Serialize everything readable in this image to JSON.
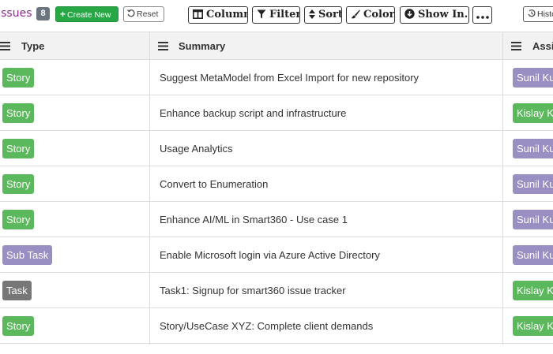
{
  "toolbar": {
    "title": "Issues",
    "count": "8",
    "create_label": "Create New",
    "reset_label": "Reset",
    "column_label": "Column",
    "filter_label": "Filter",
    "sort_label": "Sort",
    "color_label": "Color",
    "show_in_label": "Show In...",
    "history_label": "Histo"
  },
  "table": {
    "columns": [
      "Type",
      "Summary",
      "Assi"
    ],
    "rows": [
      {
        "type": "Story",
        "summary": "Suggest MetaModel from Excel Import for new repository",
        "assignee": "Sunil Ku"
      },
      {
        "type": "Story",
        "summary": "Enhance backup script and infrastructure",
        "assignee": "Kislay K"
      },
      {
        "type": "Story",
        "summary": "Usage Analytics",
        "assignee": "Sunil Ku"
      },
      {
        "type": "Story",
        "summary": "Convert to Enumeration",
        "assignee": "Sunil Ku"
      },
      {
        "type": "Story",
        "summary": "Enhance AI/ML in Smart360 - Use case 1",
        "assignee": "Sunil Ku"
      },
      {
        "type": "Sub Task",
        "summary": "Enable Microsoft login via Azure Active Directory",
        "assignee": "Sunil Ku"
      },
      {
        "type": "Task",
        "summary": "Task1: Signup for smart360 issue tracker",
        "assignee": "Kislay K"
      },
      {
        "type": "Story",
        "summary": "Story/UseCase XYZ: Complete client demands",
        "assignee": "Kislay K"
      }
    ]
  },
  "colors": {
    "story": "#5cb85c",
    "sub_task": "#9a8fc2",
    "task": "#777777",
    "assignee_sunil": "#9a8fc2",
    "assignee_kislay": "#5cb85c",
    "title": "#8b2a8b",
    "create_button": "#28a745"
  },
  "icons": [
    "plus-icon",
    "reset-icon",
    "column-icon",
    "filter-icon",
    "sort-icon",
    "paint-brush-icon",
    "download-circle-icon",
    "more-icon",
    "history-icon",
    "menu-icon"
  ]
}
